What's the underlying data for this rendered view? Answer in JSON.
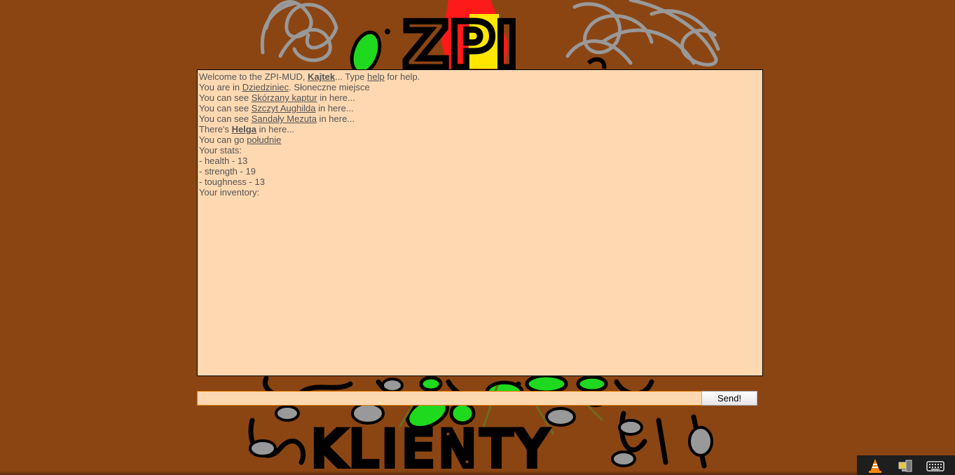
{
  "background": {
    "color": "#8b4513",
    "banner_text_top": "ZPI",
    "banner_text_bottom": "KLIENTY"
  },
  "console": {
    "background_color": "#fed8b1",
    "welcome": {
      "prefix": "Welcome to the ZPI-MUD, ",
      "player": "Kajtek",
      "middle": "... Type ",
      "help_link": "help",
      "suffix": " for help."
    },
    "location": {
      "prefix": "You are in ",
      "room": "Dziedziniec",
      "description": ". Słoneczne miejsce"
    },
    "items": [
      {
        "prefix": "You can see ",
        "name": "Skórzany kaptur",
        "suffix": " in here..."
      },
      {
        "prefix": "You can see ",
        "name": "Szczyt Aughilda",
        "suffix": " in here..."
      },
      {
        "prefix": "You can see ",
        "name": "Sandały Mezuta",
        "suffix": " in here..."
      }
    ],
    "npc": {
      "prefix": "There's ",
      "name": "Helga",
      "suffix": " in here..."
    },
    "exits": {
      "prefix": "You can go ",
      "direction": "południe"
    },
    "stats_header": "Your stats:",
    "stats": [
      "- health - 13",
      "- strength - 19",
      "- toughness - 13"
    ],
    "inventory_header": "Your inventory:"
  },
  "command": {
    "value": "",
    "send_label": "Send!"
  },
  "tray": {
    "icons": [
      "vlc-icon",
      "network-icon",
      "keyboard-icon"
    ]
  }
}
